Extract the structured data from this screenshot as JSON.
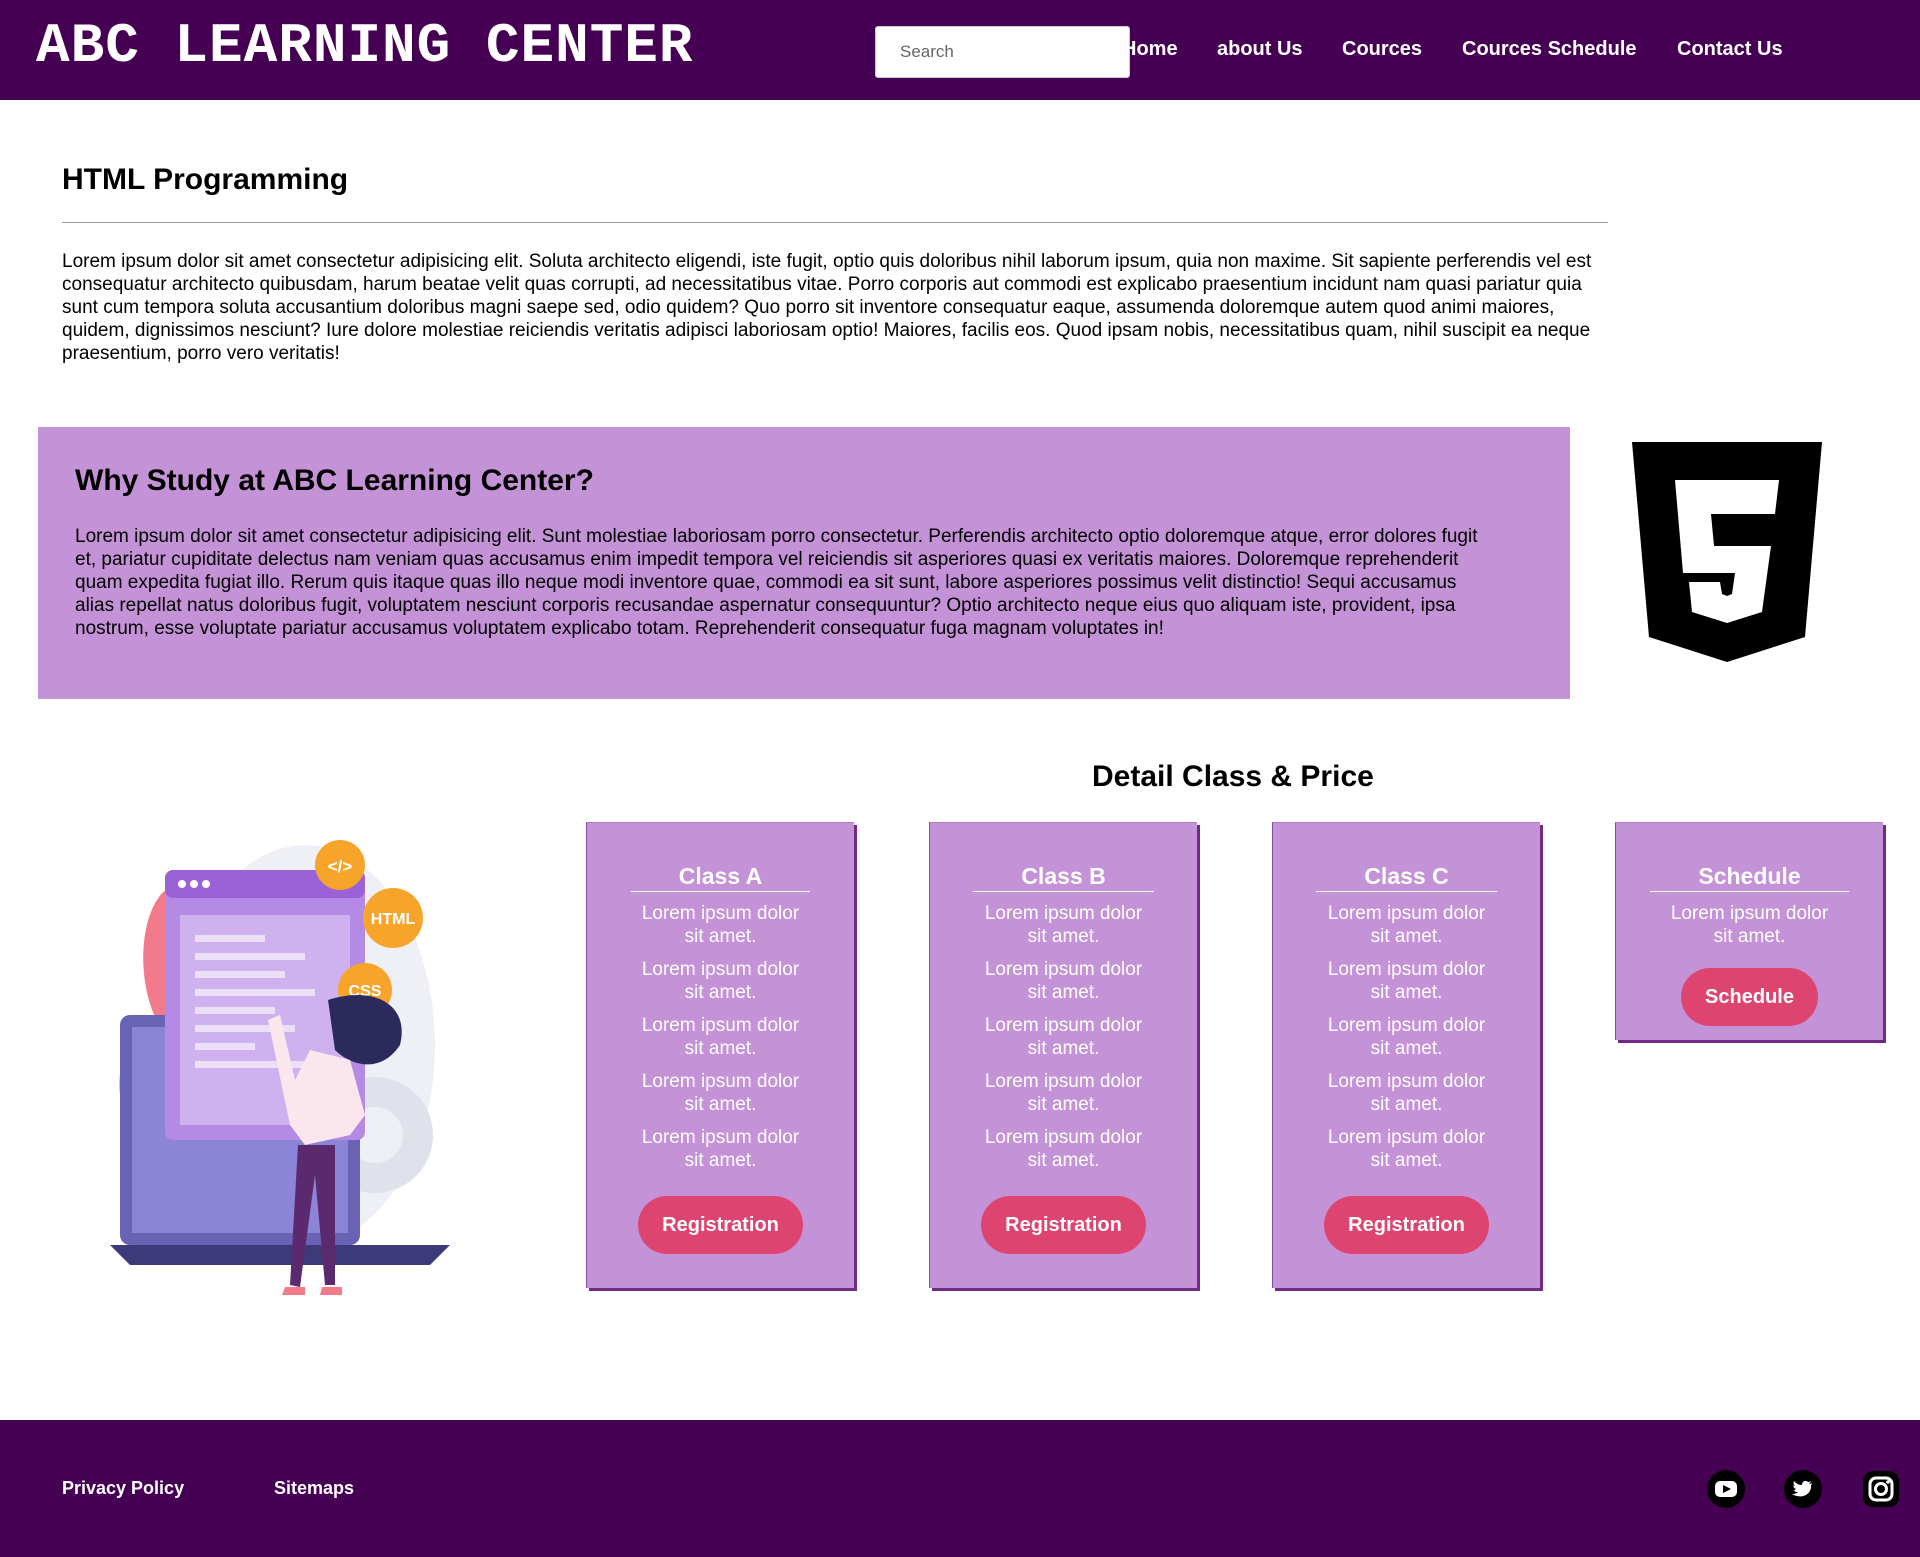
{
  "header": {
    "brand": "ABC LEARNING CENTER",
    "search_placeholder": "Search",
    "nav": [
      "Home",
      "about Us",
      "Cources",
      "Cources Schedule",
      "Contact Us"
    ]
  },
  "intro": {
    "title": "HTML Programming",
    "text": "Lorem ipsum dolor sit amet consectetur adipisicing elit. Soluta architecto eligendi, iste fugit, optio quis doloribus nihil laborum ipsum, quia non maxime. Sit sapiente perferendis vel est consequatur architecto quibusdam, harum beatae velit quas corrupti, ad necessitatibus vitae. Porro corporis aut commodi est explicabo praesentium incidunt nam quasi pariatur quia sunt cum tempora soluta accusantium doloribus magni saepe sed, odio quidem? Quo porro sit inventore consequatur eaque, assumenda doloremque autem quod animi maiores, quidem, dignissimos nesciunt? Iure dolore molestiae reiciendis veritatis adipisci laboriosam optio! Maiores, facilis eos. Quod ipsam nobis, necessitatibus quam, nihil suscipit ea neque praesentium, porro vero veritatis!"
  },
  "why": {
    "title": "Why Study at ABC Learning Center?",
    "text": "Lorem ipsum dolor sit amet consectetur adipisicing elit. Sunt molestiae laboriosam porro consectetur. Perferendis architecto optio doloremque atque, error dolores fugit et, pariatur cupiditate delectus nam veniam quas accusamus enim impedit tempora vel reiciendis sit asperiores quasi ex veritatis maiores. Doloremque reprehenderit quam expedita fugiat illo. Rerum quis itaque quas illo neque modi inventore quae, commodi ea sit sunt, labore asperiores possimus velit distinctio! Sequi accusamus alias repellat natus doloribus fugit, voluptatem nesciunt corporis recusandae aspernatur consequuntur? Optio architecto neque eius quo aliquam iste, provident, ipsa nostrum, esse voluptate pariatur accusamus voluptatem explicabo totam. Reprehenderit consequatur fuga magnam voluptates in!",
    "logo_icon": "html5-icon"
  },
  "detail": {
    "title": "Detail Class & Price",
    "illustration_icon": "developer-illustration",
    "illustration_badges": [
      "</>",
      "HTML",
      "CSS"
    ],
    "cards": [
      {
        "title": "Class A",
        "items": [
          "Lorem ipsum dolor sit amet.",
          "Lorem ipsum dolor sit amet.",
          "Lorem ipsum dolor sit amet.",
          "Lorem ipsum dolor sit amet.",
          "Lorem ipsum dolor sit amet."
        ],
        "button": "Registration"
      },
      {
        "title": "Class B",
        "items": [
          "Lorem ipsum dolor sit amet.",
          "Lorem ipsum dolor sit amet.",
          "Lorem ipsum dolor sit amet.",
          "Lorem ipsum dolor sit amet.",
          "Lorem ipsum dolor sit amet."
        ],
        "button": "Registration"
      },
      {
        "title": "Class C",
        "items": [
          "Lorem ipsum dolor sit amet.",
          "Lorem ipsum dolor sit amet.",
          "Lorem ipsum dolor sit amet.",
          "Lorem ipsum dolor sit amet.",
          "Lorem ipsum dolor sit amet."
        ],
        "button": "Registration"
      },
      {
        "title": "Schedule",
        "items": [
          "Lorem ipsum dolor sit amet."
        ],
        "button": "Schedule"
      }
    ]
  },
  "footer": {
    "links": [
      "Privacy Policy",
      "Sitemaps"
    ],
    "social": [
      "youtube-icon",
      "twitter-icon",
      "instagram-icon"
    ]
  },
  "colors": {
    "header_bg": "#450053",
    "accent_purple": "#c492d6",
    "button_pink": "#de4470",
    "text_white": "#ffffff"
  }
}
